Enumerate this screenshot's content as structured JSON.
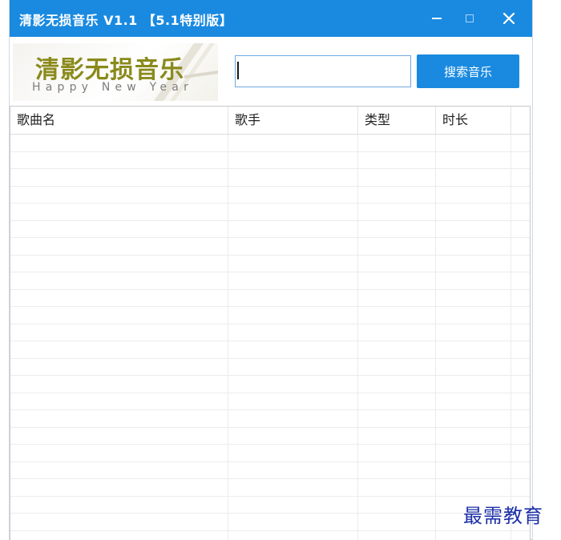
{
  "window": {
    "title": "清影无损音乐  V1.1 【5.1特别版】",
    "controls": {
      "minimize": "minimize-icon",
      "maximize": "maximize-icon",
      "close": "close-icon"
    },
    "accent_color": "#1a8ae0"
  },
  "logo": {
    "title": "清影无损音乐",
    "subtitle": "Happy New Year"
  },
  "search": {
    "value": "",
    "button_label": "搜索音乐"
  },
  "table": {
    "columns": [
      "歌曲名",
      "歌手",
      "类型",
      "时长",
      ""
    ],
    "rows": []
  },
  "watermark": "最需教育"
}
